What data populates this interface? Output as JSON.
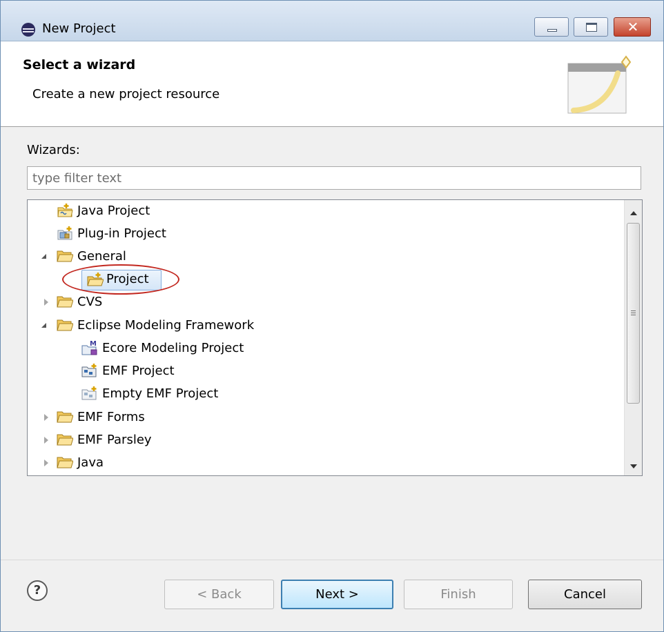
{
  "window": {
    "title": "New Project",
    "controls": {
      "minimize": "minimize-icon",
      "maximize": "maximize-icon",
      "close": "close-icon",
      "close_glyph": "✕"
    }
  },
  "header": {
    "title": "Select a wizard",
    "description": "Create a new project resource",
    "banner_icon": "new-wizard-banner-icon"
  },
  "wizards": {
    "label": "Wizards:",
    "filter_placeholder": "type filter text",
    "filter_value": ""
  },
  "tree": {
    "items": [
      {
        "label": "Java Project",
        "icon": "java-project-icon",
        "expander": "none"
      },
      {
        "label": "Plug-in Project",
        "icon": "plugin-project-icon",
        "expander": "none"
      },
      {
        "label": "General",
        "icon": "folder-icon",
        "expander": "expanded"
      },
      {
        "label": "Project",
        "icon": "project-icon",
        "expander": "none",
        "selected": true,
        "highlighted": true
      },
      {
        "label": "CVS",
        "icon": "folder-icon",
        "expander": "collapsed"
      },
      {
        "label": "Eclipse Modeling Framework",
        "icon": "folder-icon",
        "expander": "expanded"
      },
      {
        "label": "Ecore Modeling Project",
        "icon": "ecore-modeling-project-icon",
        "expander": "none"
      },
      {
        "label": "EMF Project",
        "icon": "emf-project-icon",
        "expander": "none"
      },
      {
        "label": "Empty EMF Project",
        "icon": "empty-emf-project-icon",
        "expander": "none"
      },
      {
        "label": "EMF Forms",
        "icon": "folder-icon",
        "expander": "collapsed"
      },
      {
        "label": "EMF Parsley",
        "icon": "folder-icon",
        "expander": "collapsed"
      },
      {
        "label": "Java",
        "icon": "folder-icon",
        "expander": "collapsed"
      }
    ],
    "selected_label": "Project",
    "annotation_color": "#c2271f"
  },
  "footer": {
    "help_icon": "help-icon",
    "help_glyph": "?",
    "buttons": {
      "back": "< Back",
      "next": "Next >",
      "finish": "Finish",
      "cancel": "Cancel"
    },
    "disabled": [
      "back",
      "finish"
    ]
  }
}
